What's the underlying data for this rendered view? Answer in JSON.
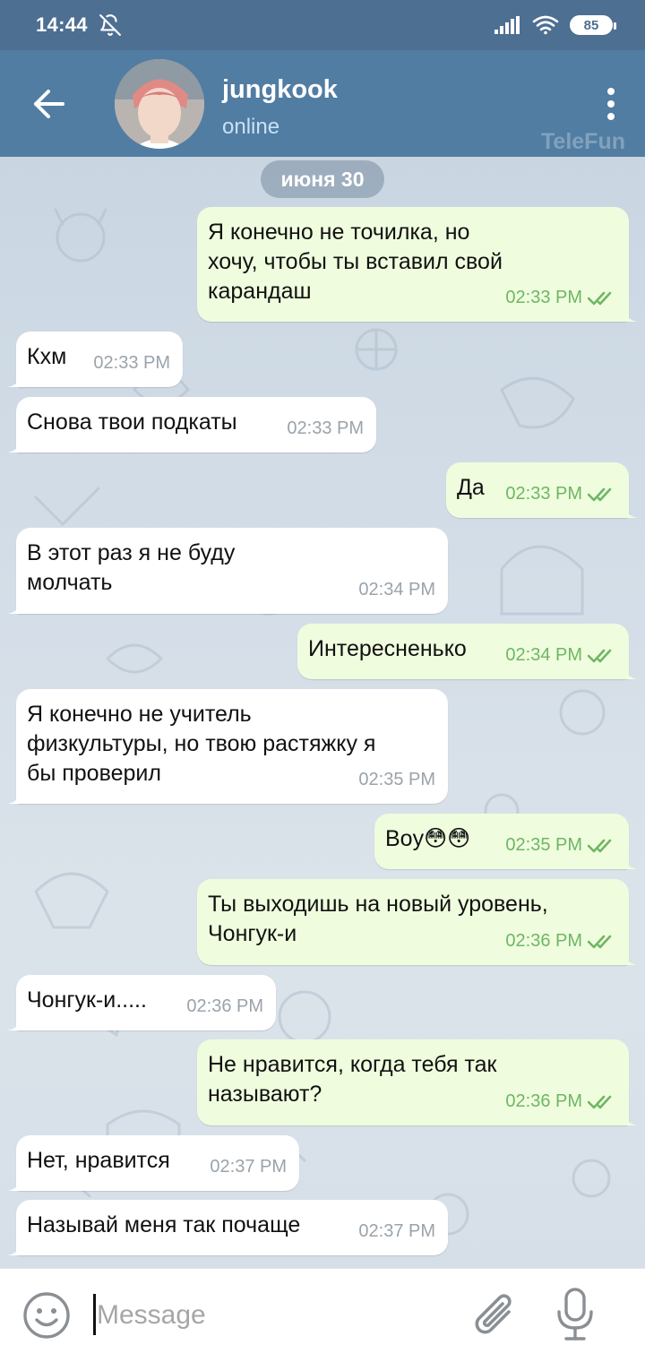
{
  "statusbar": {
    "time": "14:44",
    "battery": "85"
  },
  "header": {
    "name": "jungkook",
    "status": "online",
    "watermark": "TeleFun"
  },
  "chat": {
    "date": "июня 30",
    "messages": [
      {
        "dir": "out",
        "text": "Я конечно не точилка, но\nхочу, чтобы ты вставил свой\nкарандаш",
        "time": "02:33 PM"
      },
      {
        "dir": "in",
        "text": "Кхм",
        "time": "02:33 PM"
      },
      {
        "dir": "in",
        "text": "Снова твои подкаты",
        "time": "02:33 PM"
      },
      {
        "dir": "out",
        "text": "Да",
        "time": "02:33 PM"
      },
      {
        "dir": "in",
        "text": "В этот раз я не буду\nмолчать",
        "time": "02:34 PM"
      },
      {
        "dir": "out",
        "text": "Интересненько",
        "time": "02:34 PM"
      },
      {
        "dir": "in",
        "text": "Я конечно не учитель\nфизкультуры, но твою растяжку я\nбы проверил",
        "time": "02:35 PM"
      },
      {
        "dir": "out",
        "text": "Boy😳😳",
        "time": "02:35 PM"
      },
      {
        "dir": "out",
        "text": "Ты выходишь на новый уровень,\nЧонгук-и",
        "time": "02:36 PM"
      },
      {
        "dir": "in",
        "text": "Чонгук-и.....",
        "time": "02:36 PM"
      },
      {
        "dir": "out",
        "text": "Не нравится, когда тебя так\nназывают?",
        "time": "02:36 PM"
      },
      {
        "dir": "in",
        "text": "Нет, нравится",
        "time": "02:37 PM"
      },
      {
        "dir": "in",
        "text": "Называй меня так почаще",
        "time": "02:37 PM"
      }
    ]
  },
  "input": {
    "placeholder": "Message"
  },
  "icons": {
    "back": "arrow-left-icon",
    "menu": "more-vertical-icon",
    "emoji": "emoji-icon",
    "attach": "paperclip-icon",
    "mic": "microphone-icon",
    "read": "double-check-icon",
    "bell_off": "bell-off-icon",
    "signal": "signal-icon",
    "wifi": "wifi-icon",
    "battery": "battery-icon"
  },
  "colors": {
    "header": "#517da2",
    "statusbar": "#4d6f92",
    "outgoing_bubble": "#effdde",
    "incoming_bubble": "#ffffff",
    "read_check": "#6fb664"
  }
}
